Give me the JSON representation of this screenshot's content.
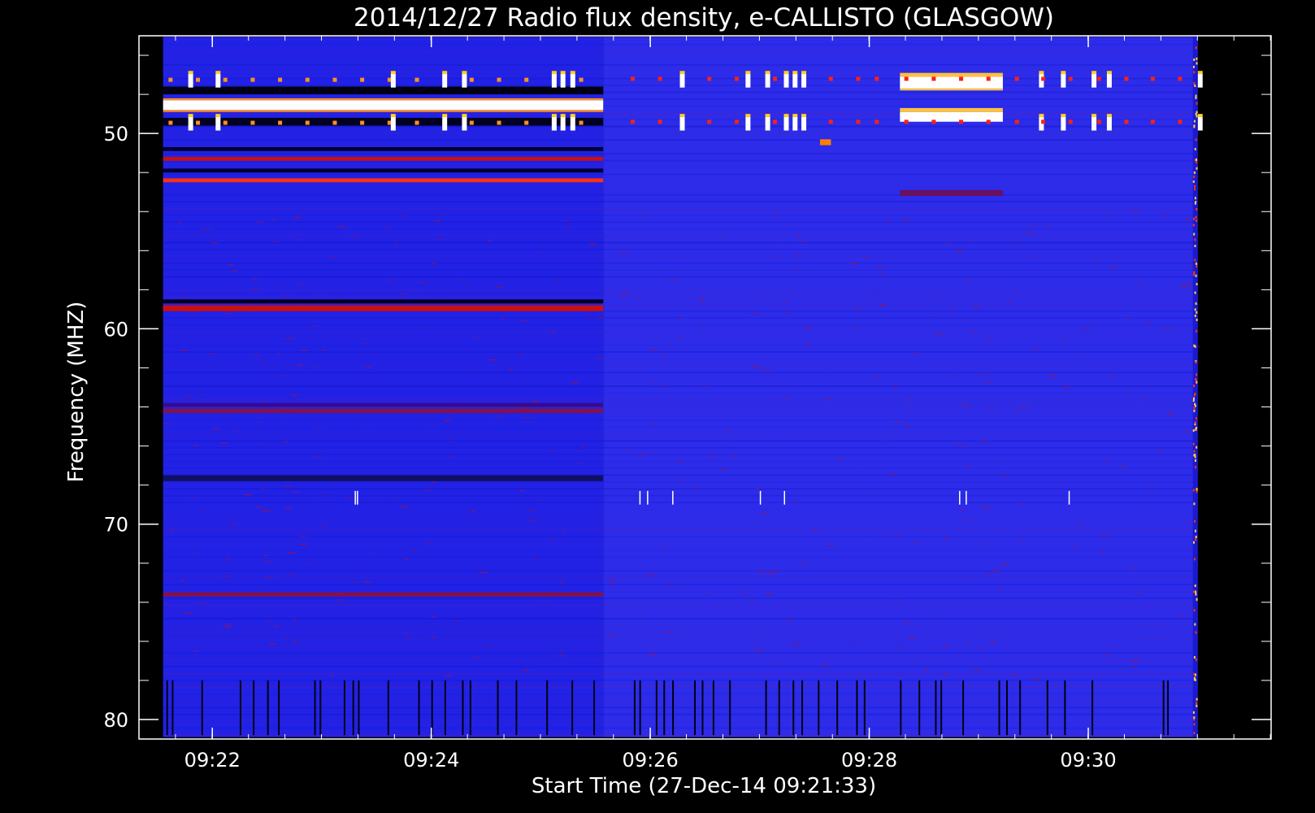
{
  "chart_data": {
    "type": "heatmap",
    "title": "2014/12/27  Radio flux density, e-CALLISTO (GLASGOW)",
    "xlabel": "Start Time (27-Dec-14 09:21:33)",
    "ylabel": "Frequency (MHZ)",
    "x_ticks": [
      "09:22",
      "09:24",
      "09:26",
      "09:28",
      "09:30"
    ],
    "y_ticks": [
      "50",
      "60",
      "70",
      "80"
    ],
    "x_tick_minutes": [
      22,
      24,
      26,
      28,
      30
    ],
    "y_tick_values": [
      50,
      60,
      70,
      80
    ],
    "xlim_minutes": [
      21.33,
      31.67
    ],
    "ylim_mhz": [
      45.0,
      81.0
    ],
    "data_time_range_minutes": [
      21.55,
      31.0
    ],
    "data_freq_range_mhz": [
      45.05,
      80.9
    ],
    "y_inverted": true,
    "colors": {
      "background": "#000000",
      "axis": "#ffffff",
      "low": "#1010f0",
      "mid": "#c81010",
      "high": "#ff8000",
      "peak": "#ffff60",
      "max": "#ffffff"
    },
    "segments": [
      {
        "t0": 21.55,
        "t1": 25.57,
        "base": "#2222e6"
      },
      {
        "t0": 25.57,
        "t1": 31.0,
        "base": "#2c2cea"
      }
    ],
    "bands": [
      {
        "t0": 21.55,
        "t1": 25.57,
        "f0": 47.6,
        "f1": 48.0,
        "color": "#000014"
      },
      {
        "t0": 21.55,
        "t1": 25.57,
        "f0": 48.3,
        "f1": 48.8,
        "color": "#ffffff"
      },
      {
        "t0": 21.55,
        "t1": 25.57,
        "f0": 48.2,
        "f1": 48.3,
        "color": "#ff9020"
      },
      {
        "t0": 21.55,
        "t1": 25.57,
        "f0": 48.8,
        "f1": 48.9,
        "color": "#ff9020"
      },
      {
        "t0": 21.55,
        "t1": 25.57,
        "f0": 49.2,
        "f1": 49.6,
        "color": "#000020"
      },
      {
        "t0": 21.55,
        "t1": 25.57,
        "f0": 50.7,
        "f1": 50.9,
        "color": "#000030"
      },
      {
        "t0": 21.55,
        "t1": 25.57,
        "f0": 51.2,
        "f1": 51.4,
        "color": "#c81010"
      },
      {
        "t0": 21.55,
        "t1": 25.57,
        "f0": 51.8,
        "f1": 52.0,
        "color": "#000030"
      },
      {
        "t0": 21.55,
        "t1": 25.57,
        "f0": 52.3,
        "f1": 52.5,
        "color": "#ff3010"
      },
      {
        "t0": 21.55,
        "t1": 25.57,
        "f0": 58.5,
        "f1": 58.7,
        "color": "#000020"
      },
      {
        "t0": 21.55,
        "t1": 25.57,
        "f0": 58.8,
        "f1": 59.1,
        "color": "#c81010"
      },
      {
        "t0": 21.55,
        "t1": 25.57,
        "f0": 63.8,
        "f1": 64.0,
        "color": "#3a0a8a"
      },
      {
        "t0": 21.55,
        "t1": 25.57,
        "f0": 64.1,
        "f1": 64.3,
        "color": "#8a1040"
      },
      {
        "t0": 21.55,
        "t1": 25.57,
        "f0": 67.5,
        "f1": 67.8,
        "color": "#101060"
      },
      {
        "t0": 21.55,
        "t1": 25.57,
        "f0": 73.5,
        "f1": 73.7,
        "color": "#8a1040"
      },
      {
        "t0": 28.28,
        "t1": 29.22,
        "f0": 47.1,
        "f1": 47.7,
        "color": "#ffffff"
      },
      {
        "t0": 28.28,
        "t1": 29.22,
        "f0": 46.9,
        "f1": 47.1,
        "color": "#ffc040"
      },
      {
        "t0": 28.28,
        "t1": 29.22,
        "f0": 47.7,
        "f1": 47.8,
        "color": "#ffc040"
      },
      {
        "t0": 28.28,
        "t1": 29.22,
        "f0": 48.9,
        "f1": 49.4,
        "color": "#ffffff"
      },
      {
        "t0": 28.28,
        "t1": 29.22,
        "f0": 48.7,
        "f1": 48.9,
        "color": "#ffc040"
      },
      {
        "t0": 28.28,
        "t1": 29.22,
        "f0": 52.9,
        "f1": 53.2,
        "color": "#6a1060"
      },
      {
        "t0": 27.55,
        "t1": 27.65,
        "f0": 50.3,
        "f1": 50.6,
        "color": "#ff8000"
      }
    ],
    "spike_times_minutes": [
      21.78,
      22.03,
      23.63,
      24.1,
      24.28,
      25.1,
      25.18,
      25.27,
      26.27,
      26.87,
      27.05,
      27.22,
      27.3,
      27.38,
      29.55,
      29.75,
      30.03,
      30.17,
      31.0
    ],
    "continuous_spike_times_minutes": [
      25.82,
      26.07,
      26.52,
      26.77,
      27.12,
      27.63,
      27.88,
      28.05,
      28.32,
      28.57,
      28.82,
      29.07,
      29.33,
      29.57,
      29.82,
      30.08,
      30.33,
      30.57,
      30.82
    ],
    "spike_freqs_mhz": [
      47.3,
      49.5
    ],
    "gap_times_minutes": [
      21.58,
      21.63,
      21.9,
      22.25,
      22.37,
      22.5,
      22.6,
      22.93,
      22.98,
      23.2,
      23.28,
      23.33,
      23.6,
      23.88,
      24.0,
      24.12,
      24.28,
      24.35,
      24.6,
      24.77,
      25.05,
      25.28,
      25.48,
      25.85,
      25.9,
      26.05,
      26.12,
      26.2,
      26.4,
      26.47,
      26.57,
      26.72,
      27.05,
      27.17,
      27.3,
      27.38,
      27.53,
      27.7,
      27.88,
      27.95,
      28.28,
      28.45,
      28.6,
      28.65,
      28.85,
      29.18,
      29.25,
      29.37,
      29.62,
      29.78,
      30.03,
      30.68,
      30.72
    ],
    "gap_freq_range_mhz": [
      78.0,
      80.8
    ]
  }
}
